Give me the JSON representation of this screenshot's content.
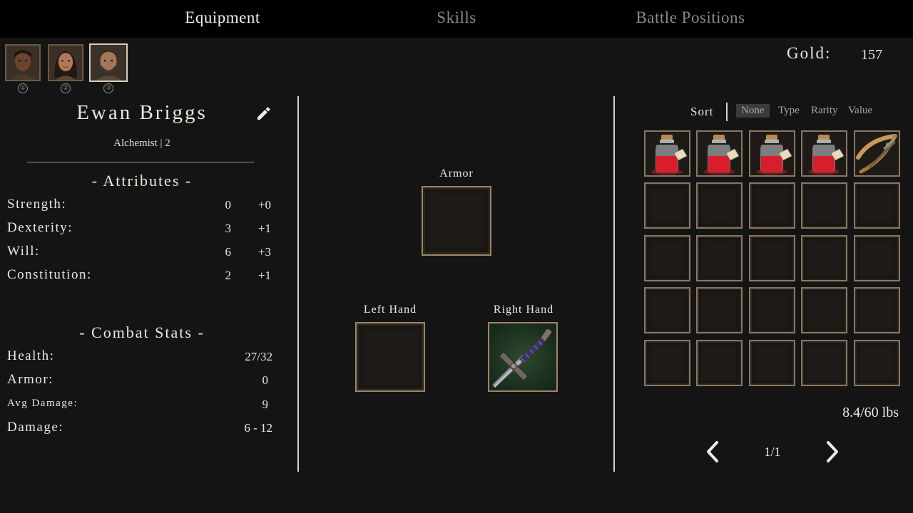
{
  "tabs": [
    {
      "label": "Equipment",
      "active": true
    },
    {
      "label": "Skills",
      "active": false
    },
    {
      "label": "Battle Positions",
      "active": false
    }
  ],
  "party": [
    {
      "number": "①",
      "selected": false
    },
    {
      "number": "②",
      "selected": false
    },
    {
      "number": "③",
      "selected": true
    }
  ],
  "gold": {
    "label": "Gold:",
    "value": "157"
  },
  "character": {
    "name": "Ewan Briggs",
    "class_level": "Alchemist | 2"
  },
  "attributes": {
    "title": "- Attributes -",
    "rows": [
      {
        "label": "Strength:",
        "value": "0",
        "modifier": "+0"
      },
      {
        "label": "Dexterity:",
        "value": "3",
        "modifier": "+1"
      },
      {
        "label": "Will:",
        "value": "6",
        "modifier": "+3"
      },
      {
        "label": "Constitution:",
        "value": "2",
        "modifier": "+1"
      }
    ]
  },
  "combat": {
    "title": "- Combat Stats -",
    "rows": [
      {
        "label": "Health:",
        "value": "27/32"
      },
      {
        "label": "Armor:",
        "value": "0"
      },
      {
        "label": "Avg Damage:",
        "value": "9"
      },
      {
        "label": "Damage:",
        "value": "6 - 12"
      }
    ]
  },
  "equipment": {
    "armor_label": "Armor",
    "left_hand_label": "Left Hand",
    "right_hand_label": "Right Hand",
    "right_hand_item": "sword-icon"
  },
  "inventory": {
    "sort_label": "Sort",
    "sort_options": [
      "None",
      "Type",
      "Rarity",
      "Value"
    ],
    "sort_selected": "None",
    "items": [
      "health-potion-icon",
      "health-potion-icon",
      "health-potion-icon",
      "health-potion-icon",
      "crossbow-icon"
    ],
    "weight": "8.4/60 lbs",
    "page": "1/1"
  },
  "colors": {
    "background": "#141414",
    "topbar": "#000000",
    "text": "#ece8df",
    "muted": "#8a8a8a",
    "slot_border": "#9b8566",
    "potion_red": "#d81e2a"
  }
}
